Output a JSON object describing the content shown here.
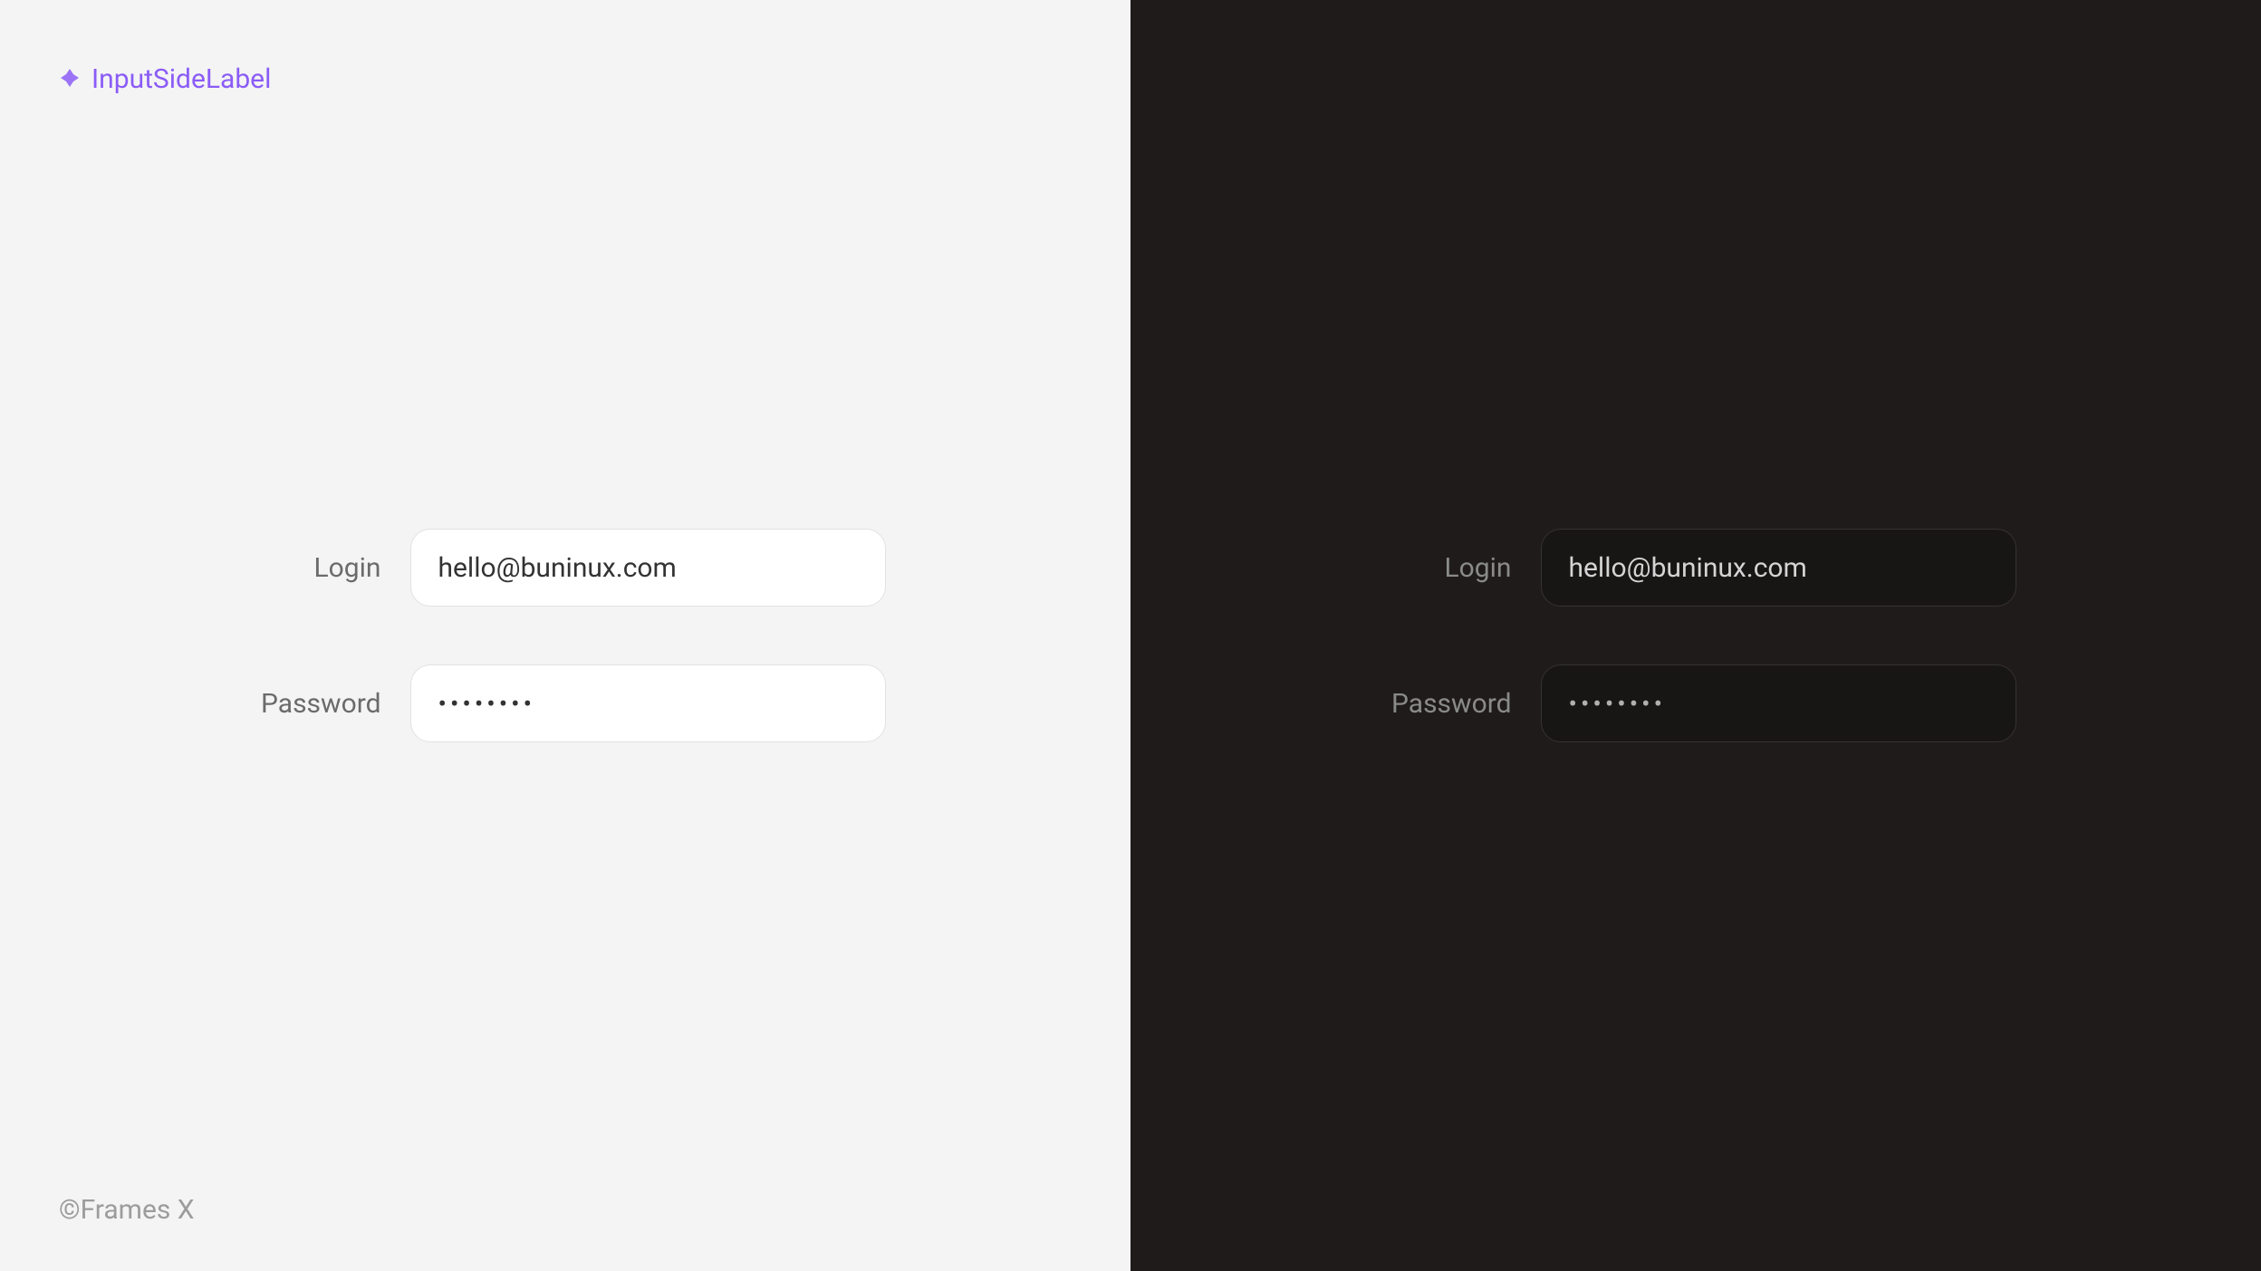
{
  "header": {
    "title": "InputSideLabel"
  },
  "footer": {
    "text": "©Frames X"
  },
  "light": {
    "loginLabel": "Login",
    "loginValue": "hello@buninux.com",
    "passwordLabel": "Password",
    "passwordValue": "••••••••"
  },
  "dark": {
    "loginLabel": "Login",
    "loginValue": "hello@buninux.com",
    "passwordLabel": "Password",
    "passwordValue": "••••••••"
  }
}
